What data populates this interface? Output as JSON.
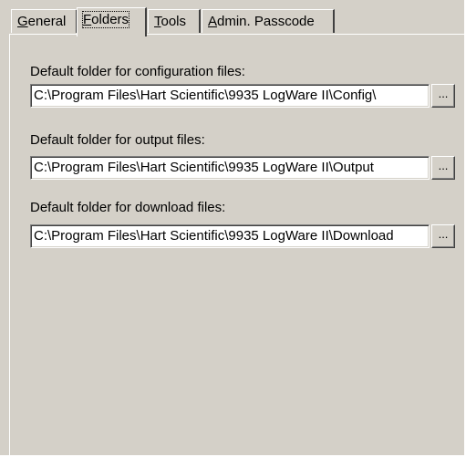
{
  "tabs": [
    {
      "label": "General",
      "mnemonic": "G",
      "rest": "eneral",
      "active": false
    },
    {
      "label": "Folders",
      "mnemonic": "F",
      "rest": "olders",
      "active": true
    },
    {
      "label": "Tools",
      "mnemonic": "T",
      "rest": "ools",
      "active": false
    },
    {
      "label": "Admin. Passcode",
      "mnemonic": "A",
      "rest": "dmin. Passcode",
      "active": false
    }
  ],
  "folders": {
    "config": {
      "label": "Default folder for configuration files:",
      "value": "C:\\Program Files\\Hart Scientific\\9935 LogWare II\\Config\\",
      "browse_label": "..."
    },
    "output": {
      "label": "Default folder for output files:",
      "value": "C:\\Program Files\\Hart Scientific\\9935 LogWare II\\Output",
      "browse_label": "..."
    },
    "download": {
      "label": "Default folder for download files:",
      "value": "C:\\Program Files\\Hart Scientific\\9935 LogWare II\\Download",
      "browse_label": "..."
    }
  },
  "colors": {
    "face": "#d4d0c8",
    "highlight": "#ffffff",
    "shadow": "#808080",
    "dark_shadow": "#404040"
  }
}
